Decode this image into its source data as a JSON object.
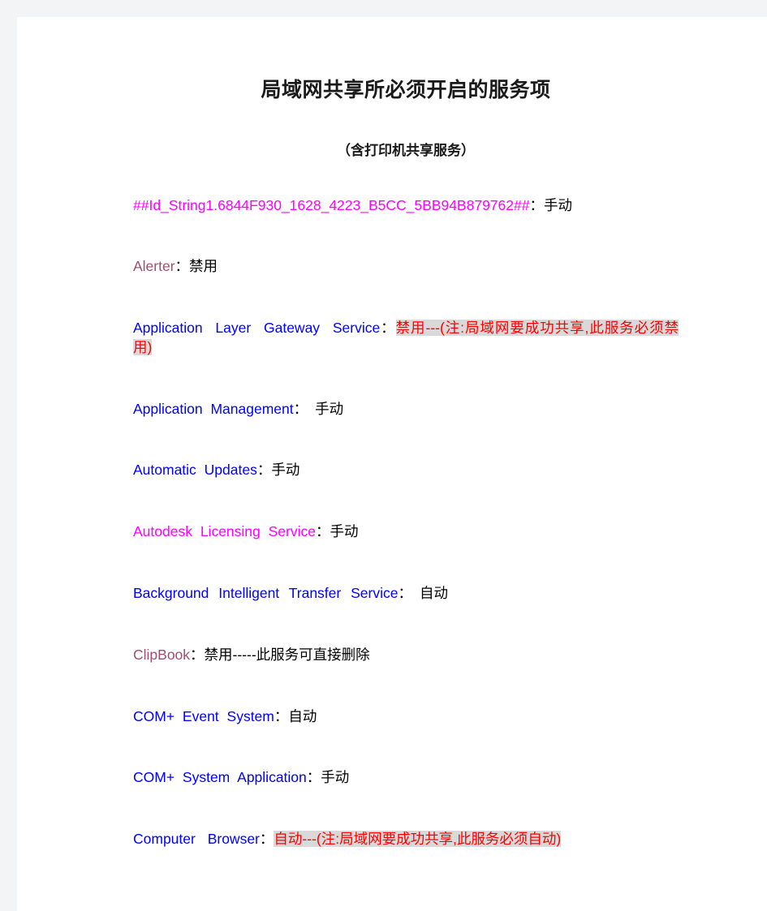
{
  "document": {
    "title": "局域网共享所必须开启的服务项",
    "subtitle": "（含打印机共享服务）"
  },
  "colors": {
    "page_background": "#ffffff",
    "canvas_background": "#f3f4f5",
    "blue": "#0000ff",
    "magenta": "#ff00ff",
    "mauve": "#9d4f72",
    "red": "#ff0000",
    "highlight": "#d9d9d9",
    "text": "#000000"
  },
  "services": [
    {
      "name": "##Id_String1.6844F930_1628_4223_B5CC_5BB94B879762##",
      "name_color": "magenta",
      "separator": "：",
      "value": "手动",
      "value_color": "text",
      "highlighted": false
    },
    {
      "name": "Alerter",
      "name_color": "mauve",
      "separator": "：",
      "value": "禁用",
      "value_color": "text",
      "highlighted": false
    },
    {
      "name": "Application Layer Gateway Service",
      "name_color": "blue",
      "separator": "：",
      "value": "禁用---(注:局域网要成功共享,此服务必须禁用)",
      "value_color": "red",
      "highlighted": true
    },
    {
      "name": "Application Management",
      "name_color": "blue",
      "separator": "：",
      "value": "手动",
      "value_color": "text",
      "highlighted": false,
      "extra_gap": true
    },
    {
      "name": "Automatic Updates",
      "name_color": "blue",
      "separator": "：",
      "value": "手动",
      "value_color": "text",
      "highlighted": false
    },
    {
      "name": "Autodesk Licensing Service",
      "name_color": "magenta",
      "separator": "：",
      "value": "手动",
      "value_color": "text",
      "highlighted": false
    },
    {
      "name": "Background Intelligent Transfer Service",
      "name_color": "blue",
      "separator": "：",
      "value": "自动",
      "value_color": "text",
      "highlighted": false,
      "extra_gap": true
    },
    {
      "name": "ClipBook",
      "name_color": "mauve",
      "separator": "：",
      "value": "禁用-----此服务可直接删除",
      "value_color": "text",
      "highlighted": false
    },
    {
      "name": "COM+ Event System",
      "name_color": "blue",
      "separator": "：",
      "value": "自动",
      "value_color": "text",
      "highlighted": false
    },
    {
      "name": "COM+ System Application",
      "name_color": "blue",
      "separator": "：",
      "value": "手动",
      "value_color": "text",
      "highlighted": false
    },
    {
      "name": "Computer Browser",
      "name_color": "blue",
      "separator": "：",
      "value": "自动---(注:局域网要成功共享,此服务必须自动)",
      "value_color": "red",
      "highlighted": true
    }
  ]
}
